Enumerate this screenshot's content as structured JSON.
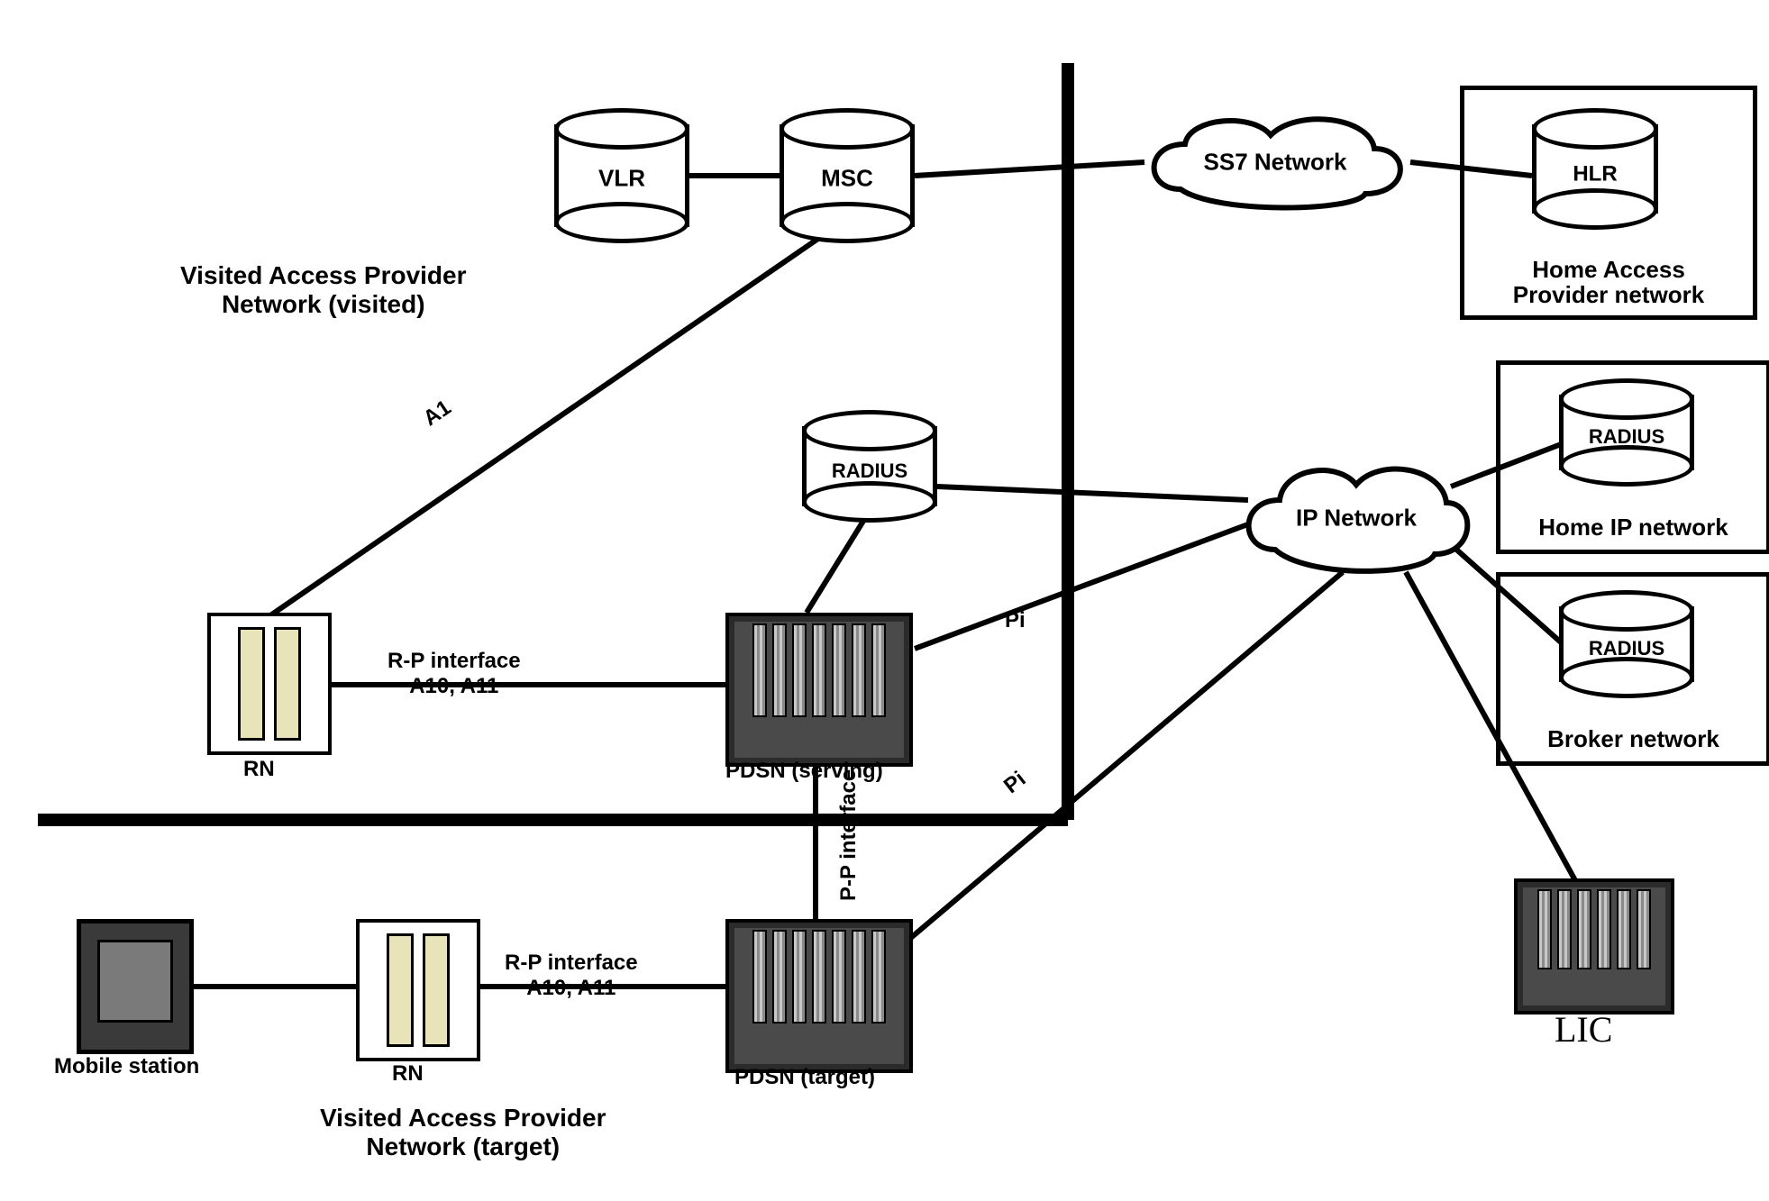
{
  "nodes": {
    "vlr": {
      "label": "VLR"
    },
    "msc": {
      "label": "MSC"
    },
    "hlr": {
      "label": "HLR"
    },
    "radius_v": {
      "label": "RADIUS"
    },
    "radius_h": {
      "label": "RADIUS"
    },
    "radius_b": {
      "label": "RADIUS"
    },
    "ss7": {
      "label": "SS7 Network"
    },
    "ip": {
      "label": "IP Network"
    },
    "pdsn_s": {
      "label": "PDSN (serving)"
    },
    "pdsn_t": {
      "label": "PDSN (target)"
    },
    "rn_s": {
      "label": "RN"
    },
    "rn_t": {
      "label": "RN"
    },
    "mobile": {
      "label": "Mobile station"
    },
    "lic": {
      "label": "LIC"
    }
  },
  "groups": {
    "home_access": {
      "caption": "Home Access\nProvider network"
    },
    "home_ip": {
      "caption": "Home IP network"
    },
    "broker": {
      "caption": "Broker network"
    }
  },
  "labels": {
    "visited_provider_visited": "Visited Access Provider\nNetwork (visited)",
    "visited_provider_target": "Visited Access Provider\nNetwork (target)",
    "a1": "A1",
    "rp1": "R-P interface\nA10, A11",
    "rp2": "R-P interface\nA10, A11",
    "pp": "P-P interface",
    "pi1": "Pi",
    "pi2": "Pi"
  },
  "edges_desc": [
    "VLR — MSC",
    "MSC — SS7 Network",
    "SS7 Network — HLR",
    "MSC — RN (serving)  [label A1]",
    "RN (serving) — PDSN (serving)  [label R-P interface A10, A11]",
    "PDSN (serving) — RADIUS (visited)",
    "RADIUS (visited) — IP Network",
    "PDSN (serving) — IP Network  [label Pi]",
    "PDSN (serving) — PDSN (target)  [label P-P interface]",
    "Mobile station — RN (target)",
    "RN (target) — PDSN (target)  [label R-P interface A10, A11]",
    "PDSN (target) — IP Network  [label Pi]",
    "IP Network — RADIUS (Home IP)",
    "IP Network — RADIUS (Broker)",
    "IP Network — LIC"
  ]
}
